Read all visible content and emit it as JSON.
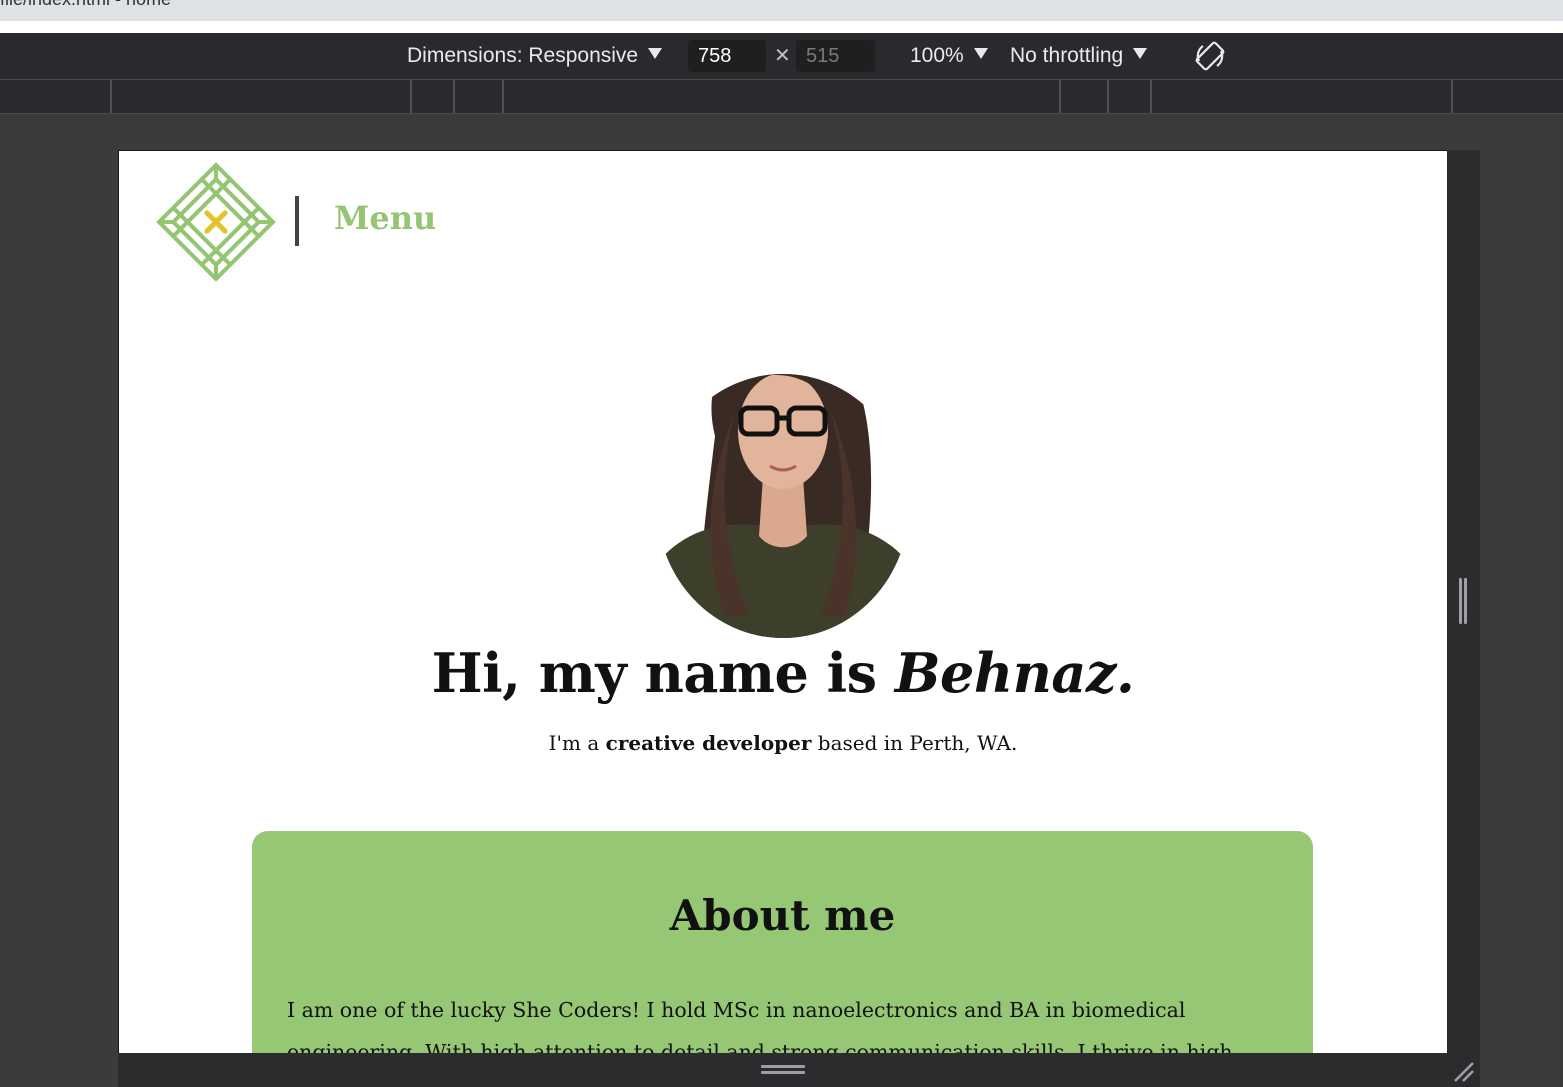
{
  "browser": {
    "url_fragment": "file/index.html - home"
  },
  "devtools": {
    "dimensions_label": "Dimensions: Responsive",
    "width": "758",
    "height": "515",
    "zoom": "100%",
    "throttling": "No throttling",
    "icons": [
      "caret-down-icon",
      "close-x-icon",
      "rotate-icon",
      "resize-grip-icon"
    ]
  },
  "site": {
    "nav": {
      "menu_label": "Menu"
    },
    "logo": {
      "colors": {
        "primary": "#93c572",
        "accent": "#e2c32b"
      }
    },
    "hero": {
      "title_prefix": "Hi, my name is ",
      "title_name": "Behnaz.",
      "subtitle_prefix": "I'm a ",
      "subtitle_bold": "creative developer",
      "subtitle_suffix": " based in Perth, WA."
    },
    "about": {
      "title": "About me",
      "body": "I am one of the lucky She Coders! I hold MSc in nanoelectronics and BA in biomedical engineering. With high attention to detail and strong communication skills, I thrive in high performing"
    }
  },
  "colors": {
    "accent_green": "#96c774",
    "toolbar_bg": "#292a2d",
    "devtools_bg": "#3b3b3b"
  }
}
